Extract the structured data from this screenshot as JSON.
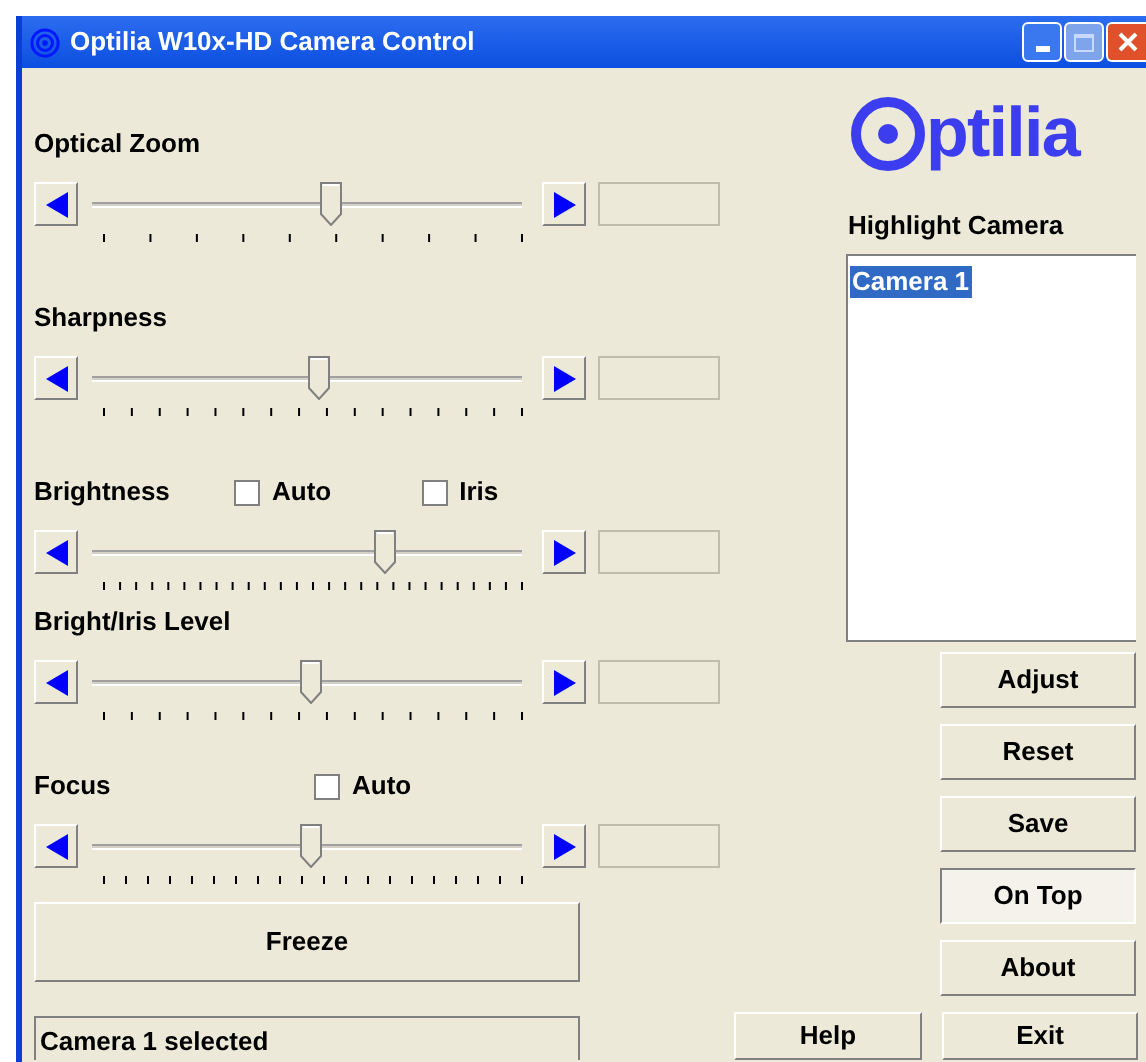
{
  "window": {
    "title": "Optilia W10x-HD Camera Control"
  },
  "logo": {
    "text": "ptilia"
  },
  "sliders": [
    {
      "label": "Optical Zoom",
      "level": 0.56
    },
    {
      "label": "Sharpness",
      "level": 0.53
    },
    {
      "label": "Brightness",
      "level": 0.69,
      "checkboxes": [
        {
          "label": "Auto",
          "checked": false
        },
        {
          "label": "Iris",
          "checked": false
        }
      ]
    },
    {
      "label": "Bright/Iris Level",
      "level": 0.51
    },
    {
      "label": "Focus",
      "level": 0.51,
      "checkboxes": [
        {
          "label": "Auto",
          "checked": false
        }
      ]
    }
  ],
  "freeze_button": "Freeze",
  "status": "Camera 1 selected",
  "camera_list": {
    "label": "Highlight Camera",
    "items": [
      {
        "label": "Camera 1",
        "selected": true
      }
    ]
  },
  "side_buttons": [
    {
      "label": "Adjust",
      "pressed": false
    },
    {
      "label": "Reset",
      "pressed": false
    },
    {
      "label": "Save",
      "pressed": false
    },
    {
      "label": "On Top",
      "pressed": true
    },
    {
      "label": "About",
      "pressed": false
    }
  ],
  "help_button": "Help",
  "exit_button": "Exit"
}
